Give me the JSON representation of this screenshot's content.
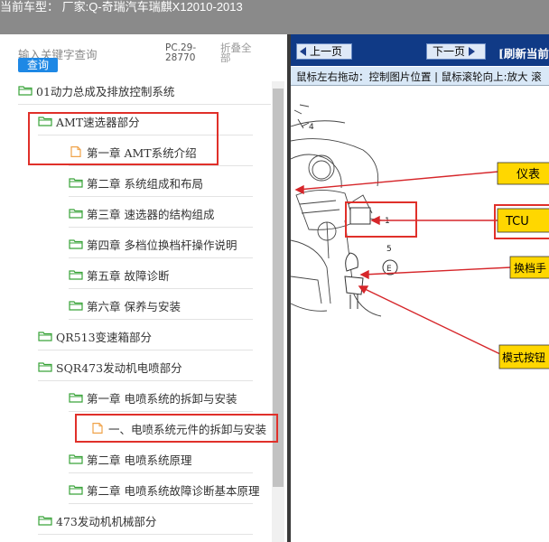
{
  "header": {
    "text": "当前车型： 厂家:Q-奇瑞汽车瑞麒X12010-2013"
  },
  "sidebar": {
    "search_placeholder": "输入关键字查询",
    "query_button": "查询",
    "pc_code_line1": "PC.29-",
    "pc_code_line2": "28770",
    "fold_all": "折叠全部",
    "tree": [
      {
        "label": "01动力总成及排放控制系统",
        "icon": "folder-open-icon"
      },
      {
        "label": "AMT速选器部分",
        "icon": "folder-open-icon"
      },
      {
        "label": "第一章 AMT系统介绍",
        "icon": "document-icon"
      },
      {
        "label": "第二章 系统组成和布局",
        "icon": "folder-open-icon"
      },
      {
        "label": "第三章 速选器的结构组成",
        "icon": "folder-open-icon"
      },
      {
        "label": "第四章 多档位换档杆操作说明",
        "icon": "folder-open-icon"
      },
      {
        "label": "第五章 故障诊断",
        "icon": "folder-open-icon"
      },
      {
        "label": "第六章 保养与安装",
        "icon": "folder-open-icon"
      },
      {
        "label": "QR513变速箱部分",
        "icon": "folder-open-icon"
      },
      {
        "label": "SQR473发动机电喷部分",
        "icon": "folder-open-icon"
      },
      {
        "label": "第一章 电喷系统的拆卸与安装",
        "icon": "folder-open-icon"
      },
      {
        "label": "一、电喷系统元件的拆卸与安装",
        "icon": "document-icon"
      },
      {
        "label": "第二章 电喷系统原理",
        "icon": "folder-open-icon"
      },
      {
        "label": "第二章 电喷系统故障诊断基本原理",
        "icon": "folder-open-icon"
      },
      {
        "label": "473发动机机械部分",
        "icon": "folder-open-icon"
      }
    ]
  },
  "viewer": {
    "prev_button": "上一页",
    "next_button": "下一页",
    "refresh": "[刷新当前",
    "hint": "鼠标左右拖动：控制图片位置 | 鼠标滚轮向上:放大  滚"
  },
  "diagram": {
    "callouts": [
      "仪表",
      "TCU",
      "换档手",
      "模式按钮"
    ],
    "numbers": [
      "4",
      "1",
      "5"
    ]
  },
  "colors": {
    "highlight_border": "#e0302a",
    "nav_bg": "#103a86",
    "callout_bg": "#ffd700",
    "arrow": "#d6262a"
  }
}
